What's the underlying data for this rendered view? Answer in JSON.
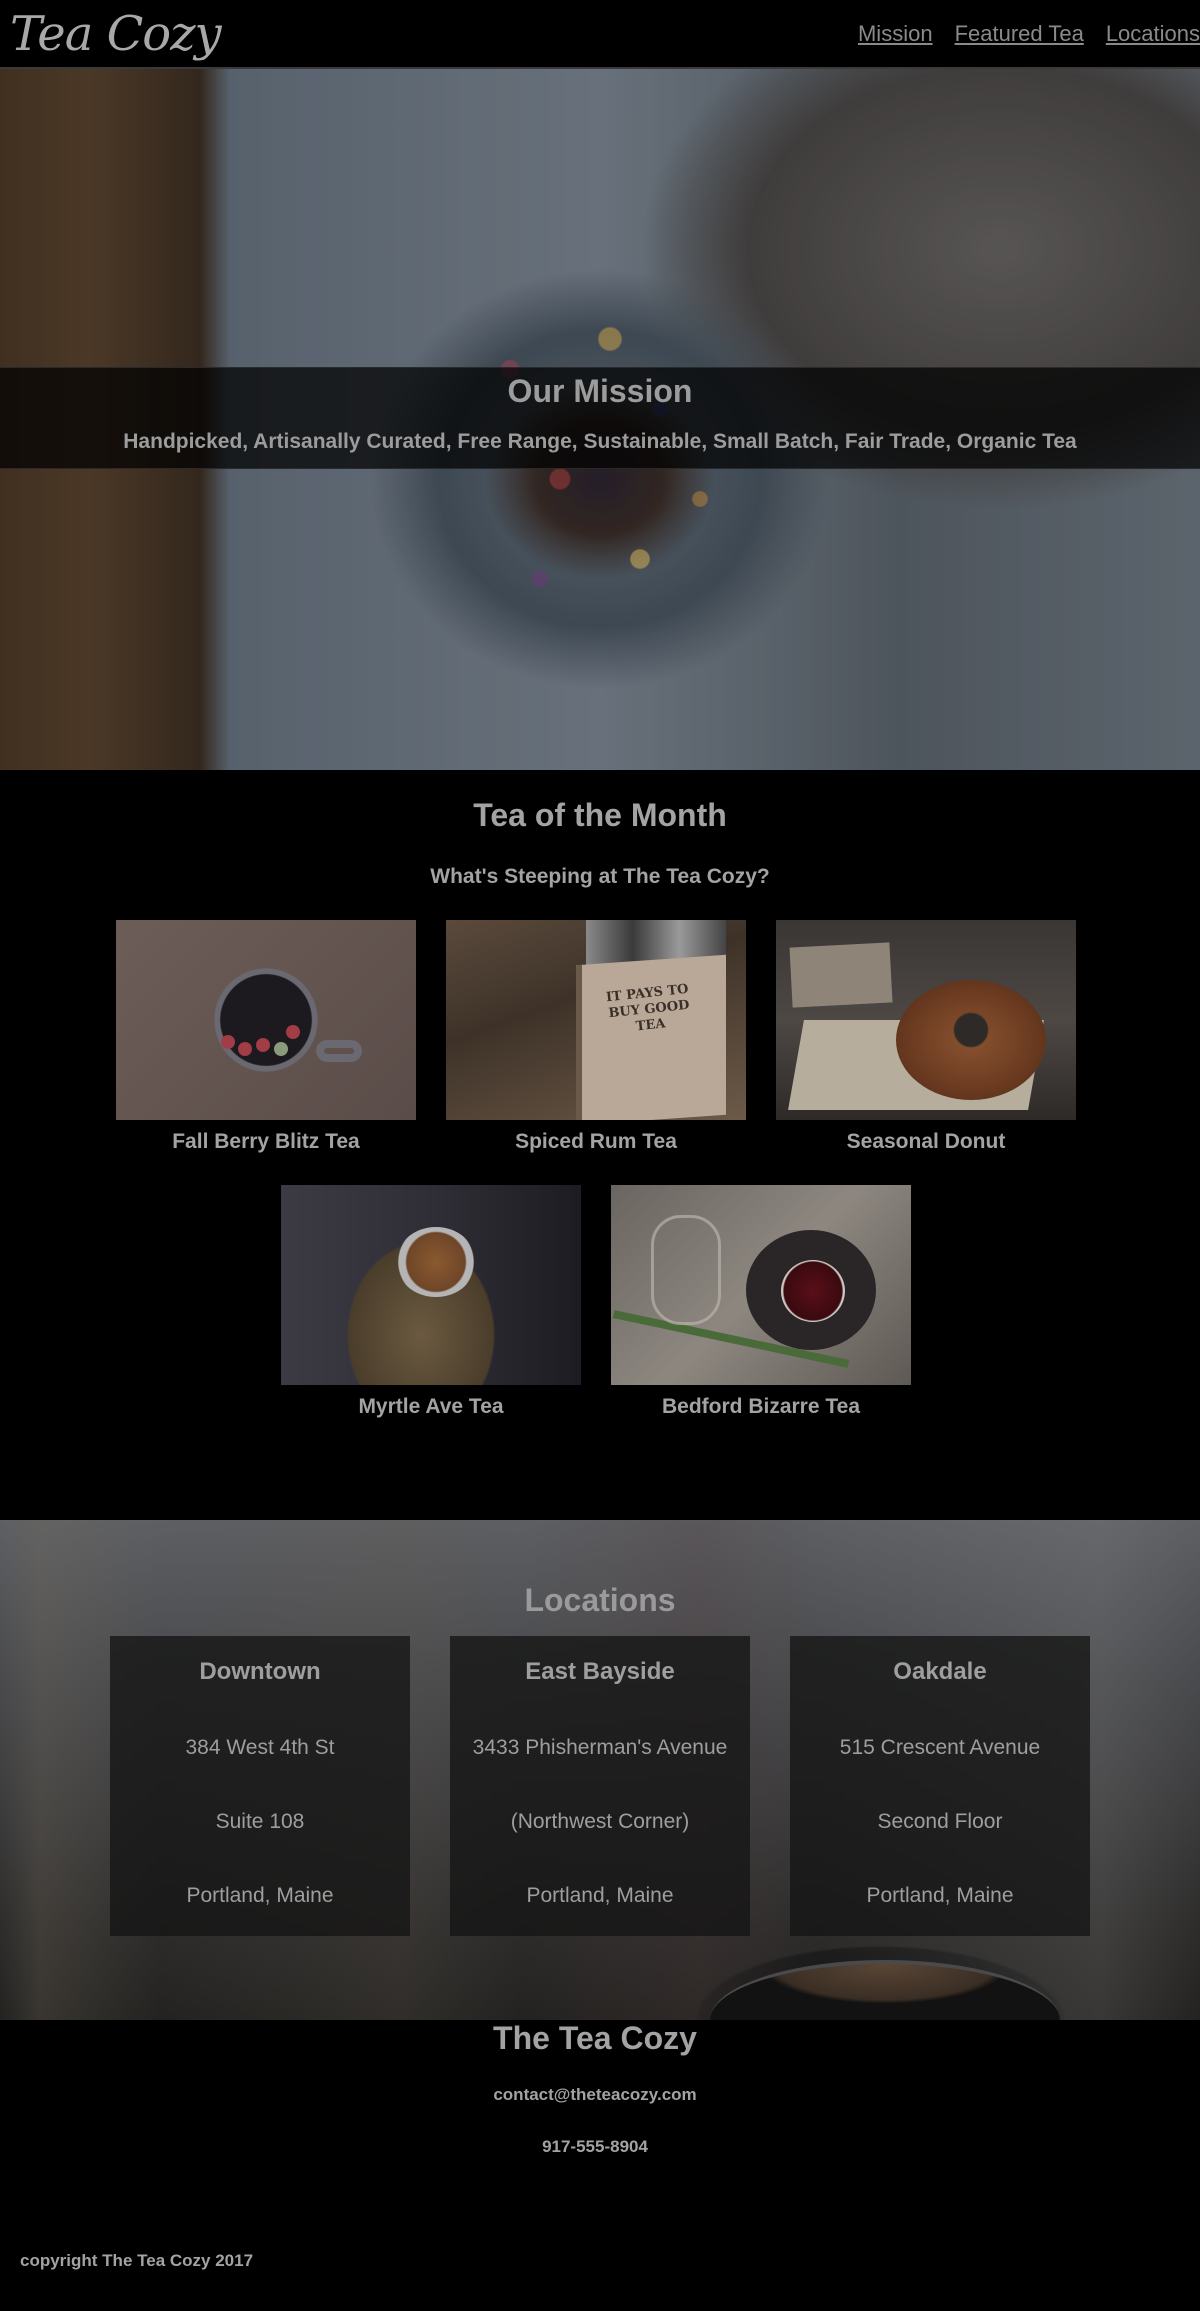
{
  "header": {
    "logo": "Tea Cozy",
    "nav": [
      "Mission",
      "Featured Tea",
      "Locations"
    ]
  },
  "mission": {
    "title": "Our Mission",
    "subtitle": "Handpicked, Artisanally Curated, Free Range, Sustainable, Small Batch, Fair Trade, Organic Tea"
  },
  "teas": {
    "title": "Tea of the Month",
    "subtitle": "What's Steeping at The Tea Cozy?",
    "items": [
      {
        "name": "Fall Berry Blitz Tea"
      },
      {
        "name": "Spiced Rum Tea",
        "box_text": "IT PAYS TO BUY GOOD TEA"
      },
      {
        "name": "Seasonal Donut"
      },
      {
        "name": "Myrtle Ave Tea"
      },
      {
        "name": "Bedford Bizarre Tea"
      }
    ]
  },
  "locations": {
    "title": "Locations",
    "items": [
      {
        "name": "Downtown",
        "line1": "384 West 4th St",
        "line2": "Suite 108",
        "line3": "Portland, Maine"
      },
      {
        "name": "East Bayside",
        "line1": "3433 Phisherman's Avenue",
        "line2": "(Northwest Corner)",
        "line3": "Portland, Maine"
      },
      {
        "name": "Oakdale",
        "line1": "515 Crescent Avenue",
        "line2": "Second Floor",
        "line3": "Portland, Maine"
      }
    ]
  },
  "footer": {
    "title": "The Tea Cozy",
    "email": "contact@theteacozy.com",
    "phone": "917-555-8904",
    "copyright": "copyright The Tea Cozy 2017"
  }
}
